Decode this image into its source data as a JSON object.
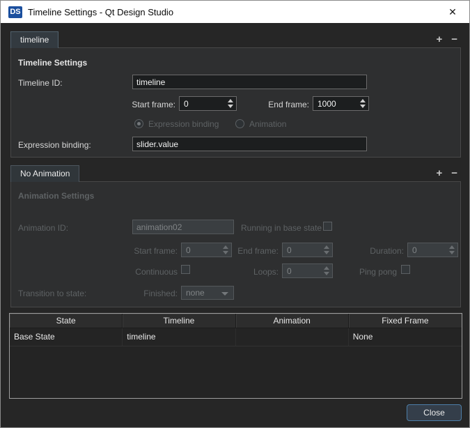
{
  "window": {
    "logo_text": "DS",
    "title": "Timeline Settings - Qt Design Studio"
  },
  "icons": {
    "close": "✕",
    "add": "+",
    "remove": "−"
  },
  "colors": {
    "logo_blue": "#1b4f9e",
    "close_button_border": "#4d7ea8",
    "titlebar_bg": "#ffffff",
    "window_bg": "#262626"
  },
  "timeline_section": {
    "tab_label": "timeline",
    "header": "Timeline Settings",
    "timeline_id": {
      "label": "Timeline ID:",
      "value": "timeline"
    },
    "start_frame": {
      "label": "Start frame:",
      "value": "0"
    },
    "end_frame": {
      "label": "End frame:",
      "value": "1000"
    },
    "binding_radio": {
      "expression_label": "Expression binding",
      "animation_label": "Animation"
    },
    "expression_binding": {
      "label": "Expression binding:",
      "value": "slider.value"
    }
  },
  "animation_section": {
    "tab_label": "No Animation",
    "header": "Animation Settings",
    "animation_id": {
      "label": "Animation ID:",
      "value": "animation02"
    },
    "running_in_base_state_label": "Running in base state",
    "start_frame": {
      "label": "Start frame:",
      "value": "0"
    },
    "end_frame": {
      "label": "End frame:",
      "value": "0"
    },
    "duration": {
      "label": "Duration:",
      "value": "0"
    },
    "continuous_label": "Continuous",
    "loops": {
      "label": "Loops:",
      "value": "0"
    },
    "ping_pong_label": "Ping pong",
    "transition_label": "Transition to state:",
    "finished": {
      "label": "Finished:",
      "value": "none"
    }
  },
  "table": {
    "headers": [
      "State",
      "Timeline",
      "Animation",
      "Fixed Frame"
    ],
    "rows": [
      [
        "Base State",
        "timeline",
        "",
        "None"
      ]
    ]
  },
  "footer": {
    "close_label": "Close"
  }
}
